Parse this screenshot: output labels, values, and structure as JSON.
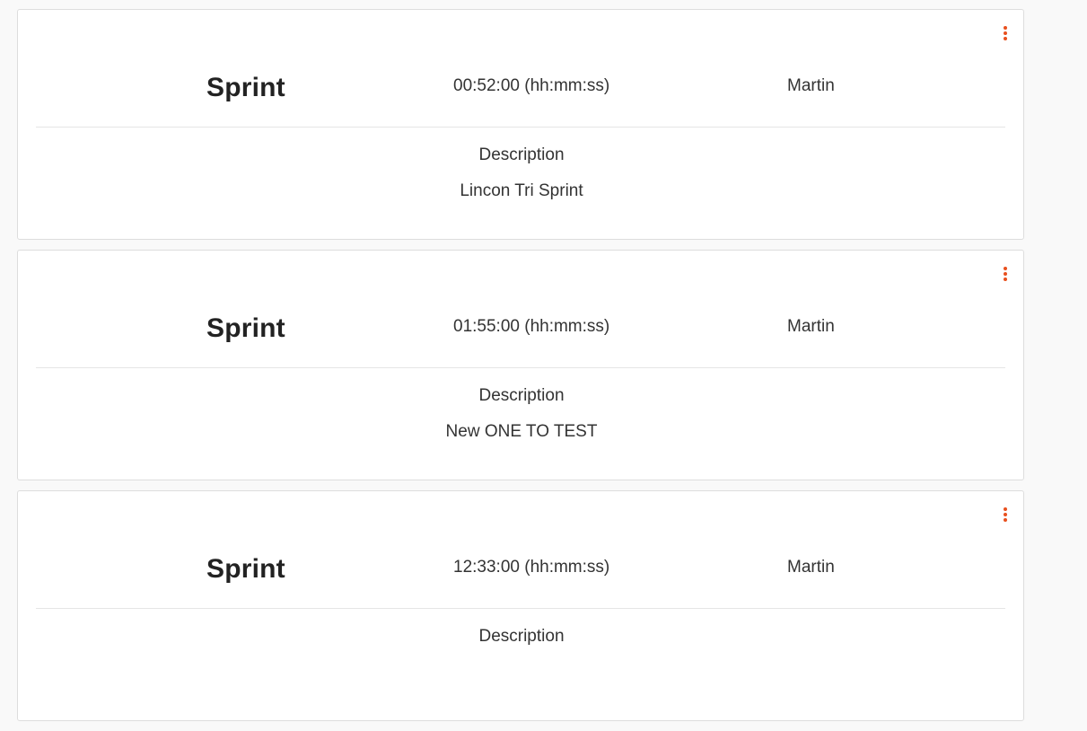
{
  "workouts": [
    {
      "title": "Sprint",
      "duration": "00:52:00 (hh:mm:ss)",
      "athlete": "Martin",
      "description_label": "Description",
      "description": "Lincon Tri Sprint",
      "menu_icon": "more-vertical-icon"
    },
    {
      "title": "Sprint",
      "duration": "01:55:00 (hh:mm:ss)",
      "athlete": "Martin",
      "description_label": "Description",
      "description": "New ONE TO TEST",
      "menu_icon": "more-vertical-icon"
    },
    {
      "title": "Sprint",
      "duration": "12:33:00 (hh:mm:ss)",
      "athlete": "Martin",
      "description_label": "Description",
      "description": "",
      "menu_icon": "more-vertical-icon"
    }
  ],
  "colors": {
    "accent": "#e8501e",
    "card_border": "#dddddd",
    "background": "#f9f9f9"
  }
}
